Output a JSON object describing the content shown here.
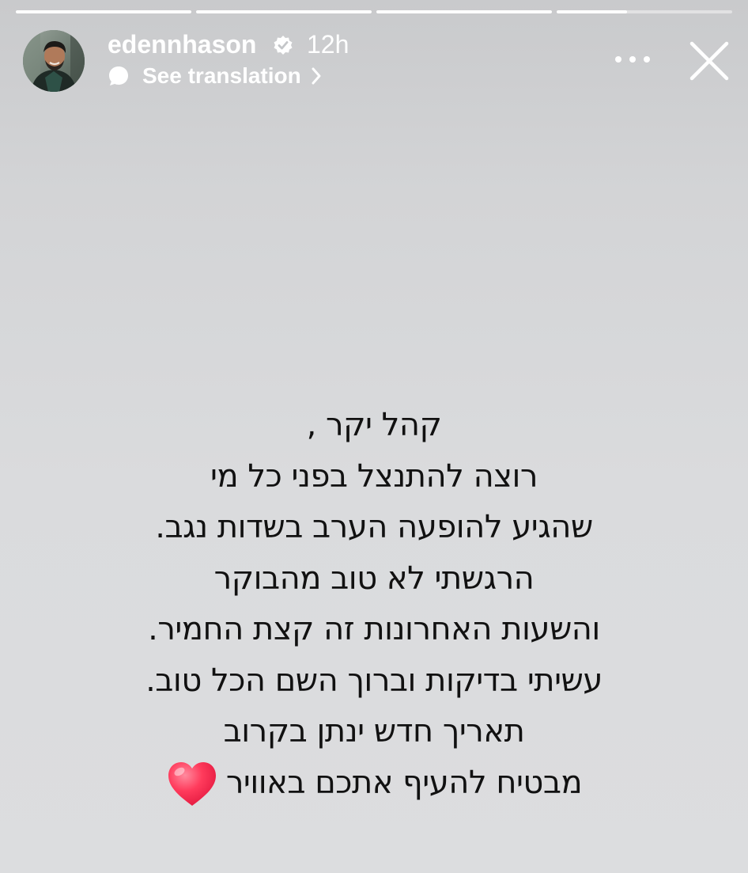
{
  "story": {
    "progress": [
      1.0,
      1.0,
      1.0,
      0.4
    ],
    "username": "edennhason",
    "timestamp": "12h",
    "translation_label": "See translation",
    "icons": {
      "verified": "verified-badge-icon",
      "translate": "speech-bubble-icon",
      "chevron": "chevron-right-icon",
      "more": "more-options-icon",
      "close": "close-icon",
      "heart": "red-heart-emoji"
    },
    "colors": {
      "verified": "#1d9bf0",
      "heart": "#ff3b5c"
    }
  },
  "message": {
    "lines": [
      "קהל יקר ,",
      "רוצה להתנצל בפני כל מי",
      "שהגיע להופעה הערב בשדות נגב.",
      "הרגשתי לא טוב מהבוקר",
      "והשעות האחרונות זה קצת החמיר.",
      "עשיתי בדיקות וברוך השם הכל טוב.",
      "תאריך חדש ינתן בקרוב",
      "מבטיח להעיף אתכם באוויר"
    ]
  }
}
